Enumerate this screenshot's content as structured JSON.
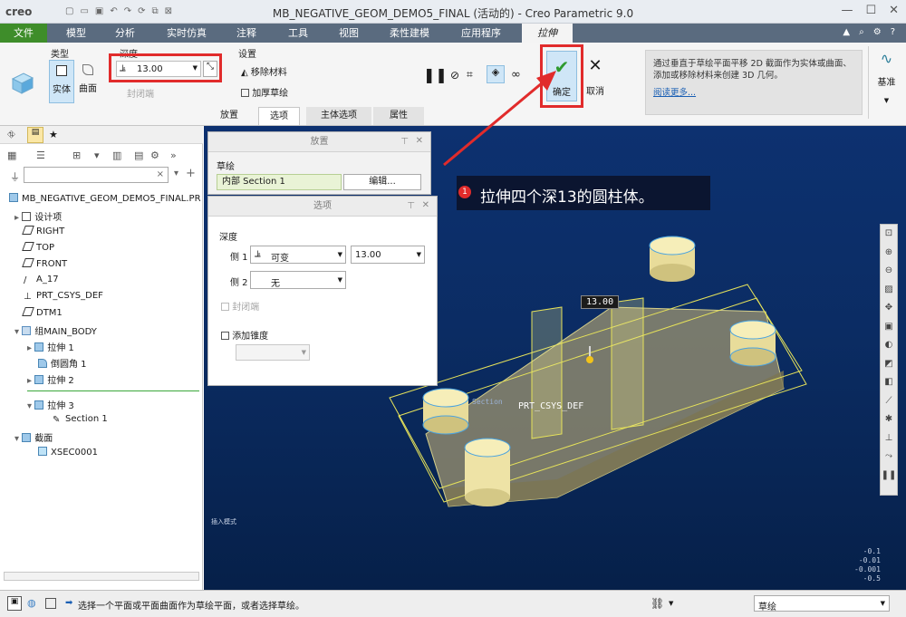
{
  "titlebar": {
    "logo": "creo",
    "title": "MB_NEGATIVE_GEOM_DEMO5_FINAL (活动的) - Creo Parametric 9.0",
    "qat_icons": [
      "new-icon",
      "open-icon",
      "save-icon",
      "undo-icon",
      "redo-icon",
      "regenerate-icon",
      "window-icon",
      "close-window-icon"
    ]
  },
  "menu": {
    "tabs": [
      "文件",
      "模型",
      "分析",
      "实时仿真",
      "注释",
      "工具",
      "视图",
      "柔性建模",
      "应用程序",
      "拉伸"
    ]
  },
  "ribbon": {
    "type_label": "类型",
    "solid_label": "实体",
    "surface_label": "曲面",
    "depth_label": "深度",
    "depth_value": "13.00",
    "closed_ends_label": "封闭端",
    "settings_label": "设置",
    "remove_material_label": "移除材料",
    "thicken_sketch_label": "加厚草绘",
    "ok_label": "确定",
    "cancel_label": "取消",
    "help_text": "通过垂直于草绘平面平移 2D 截面作为实体或曲面、添加或移除材料来创建 3D 几何。",
    "help_link": "阅读更多...",
    "datum_label": "基准",
    "subtabs": [
      "放置",
      "选项",
      "主体选项",
      "属性"
    ]
  },
  "tree": {
    "filter_placeholder": "",
    "root": "MB_NEGATIVE_GEOM_DEMO5_FINAL.PR",
    "items": [
      {
        "label": "设计项",
        "icon": "design-items-icon"
      },
      {
        "label": "RIGHT",
        "icon": "plane-icon"
      },
      {
        "label": "TOP",
        "icon": "plane-icon"
      },
      {
        "label": "FRONT",
        "icon": "plane-icon"
      },
      {
        "label": "A_17",
        "icon": "axis-icon"
      },
      {
        "label": "PRT_CSYS_DEF",
        "icon": "csys-icon"
      },
      {
        "label": "DTM1",
        "icon": "plane-icon"
      },
      {
        "label": "组MAIN_BODY",
        "icon": "group-icon"
      },
      {
        "label": "拉伸 1",
        "icon": "extrude-icon"
      },
      {
        "label": "倒圆角 1",
        "icon": "round-icon"
      },
      {
        "label": "拉伸 2",
        "icon": "extrude-icon"
      },
      {
        "label": "拉伸 3",
        "icon": "extrude-icon"
      },
      {
        "label": "Section 1",
        "icon": "sketch-icon"
      },
      {
        "label": "截面",
        "icon": "section-icon"
      },
      {
        "label": "XSEC0001",
        "icon": "xsec-icon"
      }
    ]
  },
  "placement_dialog": {
    "title": "放置",
    "sketch_label": "草绘",
    "section_value": "内部 Section 1",
    "edit_button": "编辑..."
  },
  "options_dialog": {
    "title": "选项",
    "depth_label": "深度",
    "side1_label": "侧 1",
    "side1_type": "可变",
    "side1_value": "13.00",
    "side2_label": "侧 2",
    "side2_value": "无",
    "closed_ends_label": "封闭端",
    "add_taper_label": "添加锥度"
  },
  "annotation": {
    "number": "1",
    "text": "拉伸四个深13的圆柱体。"
  },
  "viewport": {
    "dim_label": "13.00",
    "csys_label": "PRT_CSYS_DEF",
    "section_label": "Section",
    "small_label": "插入模式",
    "readout": [
      "-0.1",
      "-0.01",
      "-0.001",
      "-0.5"
    ]
  },
  "status": {
    "message": "选择一个平面或平面曲面作为草绘平面，或者选择草绘。",
    "filter_value": "草绘"
  },
  "colors": {
    "menubar": "#5a6b7f",
    "file_tab": "#3e8d2a",
    "highlight_red": "#e12b2b",
    "ok_green": "#2e9a2e",
    "viewport_blue": "#0b2c63"
  }
}
